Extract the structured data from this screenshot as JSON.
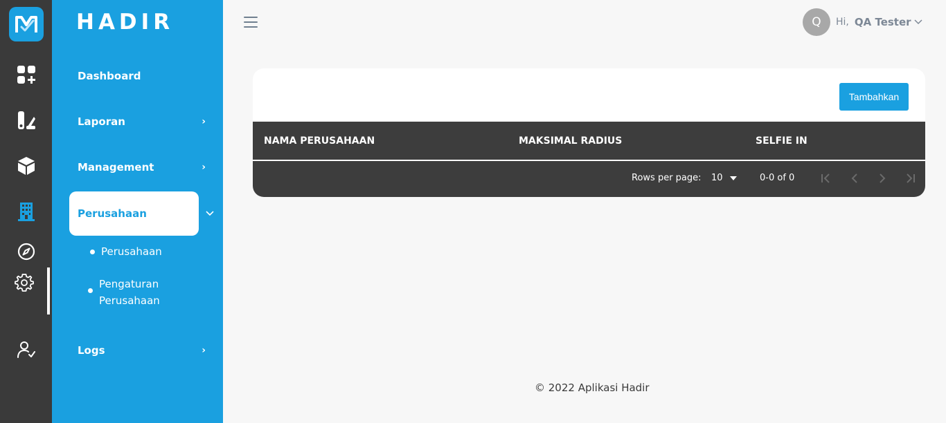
{
  "brand": "HADIR",
  "colors": {
    "primary": "#1aa0e0",
    "rail": "#3a3a3a",
    "table_header": "#3d3d3d"
  },
  "rail_icons": [
    "app-logo-icon",
    "dashboard-add-icon",
    "report-brush-icon",
    "cube-icon",
    "building-icon",
    "compass-icon",
    "gear-icon",
    "user-check-icon"
  ],
  "sidebar": {
    "dashboard": "Dashboard",
    "laporan": "Laporan",
    "management": "Management",
    "perusahaan": "Perusahaan",
    "sub_perusahaan": "Perusahaan",
    "sub_pengaturan_1": "Pengaturan",
    "sub_pengaturan_2": "Perusahaan",
    "logs": "Logs"
  },
  "header": {
    "avatar_initial": "Q",
    "greeting": "Hi,",
    "user_name": "QA Tester"
  },
  "card": {
    "add_button": "Tambahkan",
    "columns": [
      "NAMA PERUSAHAAN",
      "MAKSIMAL RADIUS",
      "SELFIE IN"
    ],
    "rows_per_page_label": "Rows per page:",
    "rows_per_page_value": "10",
    "range": "0-0 of 0"
  },
  "footer": "© 2022 Aplikasi Hadir"
}
